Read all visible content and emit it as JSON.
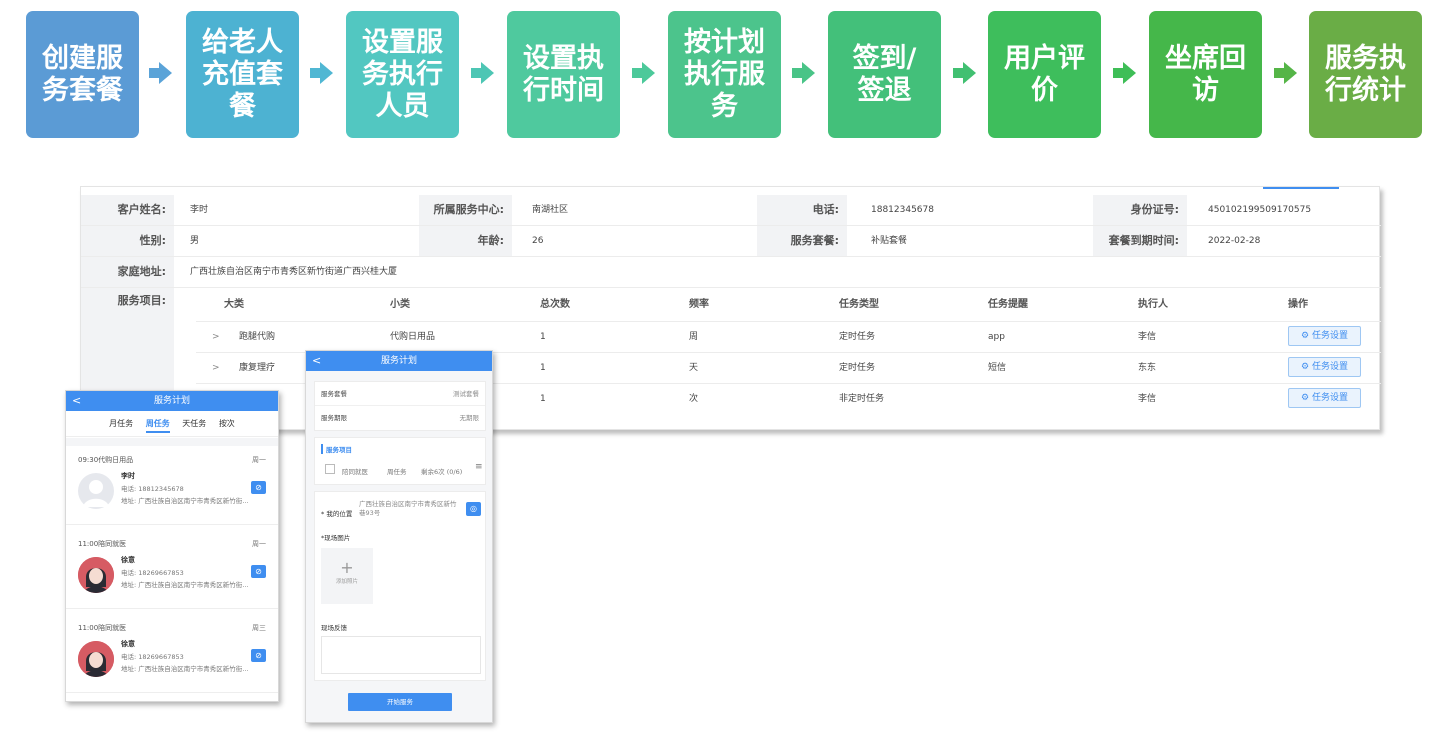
{
  "flow": {
    "steps": [
      {
        "lines": [
          "创建服",
          "务套餐"
        ],
        "color": "#5b9bd5"
      },
      {
        "lines": [
          "给老人",
          "充值套",
          "餐"
        ],
        "color": "#4db2d2"
      },
      {
        "lines": [
          "设置服",
          "务执行",
          "人员"
        ],
        "color": "#52c7c1"
      },
      {
        "lines": [
          "设置执",
          "行时间"
        ],
        "color": "#4fc99e"
      },
      {
        "lines": [
          "按计划",
          "执行服",
          "务"
        ],
        "color": "#4cc48c"
      },
      {
        "lines": [
          "签到/",
          "签退"
        ],
        "color": "#43c07a"
      },
      {
        "lines": [
          "用户评",
          "价"
        ],
        "color": "#3ebe5c"
      },
      {
        "lines": [
          "坐席回",
          "访"
        ],
        "color": "#45b74a"
      },
      {
        "lines": [
          "服务执",
          "行统计"
        ],
        "color": "#6aad46"
      }
    ],
    "arrow_colors": [
      "#5aa3d8",
      "#50b7d3",
      "#4dc6b4",
      "#4cc99a",
      "#49c487",
      "#41c071",
      "#3ebe57",
      "#55b547"
    ]
  },
  "customer": {
    "name_label": "客户姓名:",
    "name": "李时",
    "center_label": "所属服务中心:",
    "center": "南湖社区",
    "phone_label": "电话:",
    "phone": "18812345678",
    "id_label": "身份证号:",
    "id": "450102199509170575",
    "gender_label": "性别:",
    "gender": "男",
    "age_label": "年龄:",
    "age": "26",
    "package_label": "服务套餐:",
    "package": "补贴套餐",
    "expire_label": "套餐到期时间:",
    "expire": "2022-02-28",
    "address_label": "家庭地址:",
    "address": "广西壮族自治区南宁市青秀区新竹街道广西兴桂大厦",
    "items_label": "服务项目:"
  },
  "table": {
    "headers": [
      "大类",
      "小类",
      "总次数",
      "频率",
      "任务类型",
      "任务提醒",
      "执行人",
      "操作"
    ],
    "rows": [
      {
        "expand": ">",
        "category": "跑腿代购",
        "sub": "代购日用品",
        "count": "1",
        "freq": "周",
        "type": "定时任务",
        "remind": "app",
        "executor": "李信",
        "action": "任务设置"
      },
      {
        "expand": ">",
        "category": "康复理疗",
        "sub": "",
        "count": "1",
        "freq": "天",
        "type": "定时任务",
        "remind": "短信",
        "executor": "东东",
        "action": "任务设置"
      },
      {
        "expand": "",
        "category": "",
        "sub": "",
        "count": "1",
        "freq": "次",
        "type": "非定时任务",
        "remind": "",
        "executor": "李信",
        "action": "任务设置"
      }
    ]
  },
  "phone_left": {
    "back": "<",
    "title": "服务计划",
    "tabs": [
      "月任务",
      "周任务",
      "天任务",
      "按次"
    ],
    "active_tab": 1,
    "cards": [
      {
        "time": "09:30代购日用品",
        "day": "周一",
        "name": "李时",
        "phone": "电话: 18812345678",
        "addr": "地址: 广西壮族自治区南宁市青秀区新竹街…",
        "avatar": "plain"
      },
      {
        "time": "11:00陪同就医",
        "day": "周一",
        "name": "徐意",
        "phone": "电话: 18269667853",
        "addr": "地址: 广西壮族自治区南宁市青秀区新竹街…",
        "avatar": "girl"
      },
      {
        "time": "11:00陪同就医",
        "day": "周三",
        "name": "徐意",
        "phone": "电话: 18269667853",
        "addr": "地址: 广西壮族自治区南宁市青秀区新竹街…",
        "avatar": "girl"
      }
    ]
  },
  "phone_right": {
    "back": "<",
    "title": "服务计划",
    "package_label": "服务套餐",
    "package_value": "测试套餐",
    "period_label": "服务期限",
    "period_value": "无期限",
    "items_title": "服务项目",
    "item_name": "陪同就医",
    "item_freq": "周任务",
    "item_left": "剩余6次 (0/6)",
    "location_label": "* 我的位置",
    "location_value": "广西壮族自治区南宁市青秀区新竹巷93号",
    "photo_label": "*现场图片",
    "add_photo": "添加照片",
    "feedback_label": "现场反馈",
    "start_button": "开始服务"
  }
}
